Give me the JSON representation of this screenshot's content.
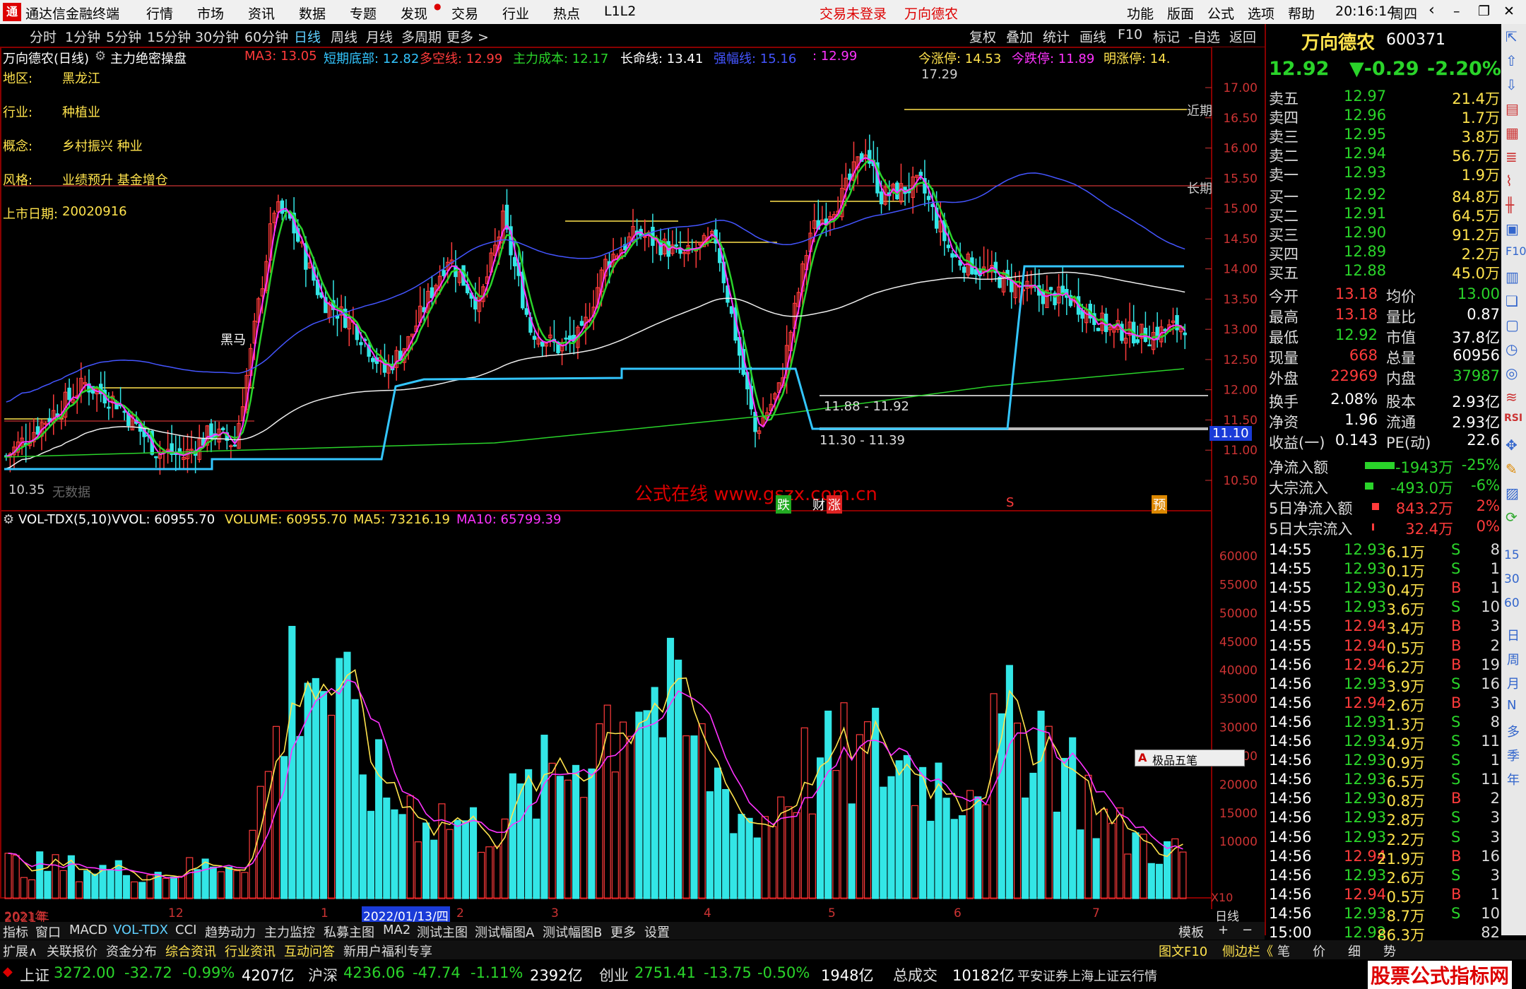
{
  "titlebar": {
    "app_title": "通达信金融终端",
    "menus": [
      "行情",
      "市场",
      "资讯",
      "数据",
      "专题",
      "发现",
      "交易",
      "行业",
      "热点",
      "L1L2"
    ],
    "login_status": "交易未登录",
    "stock_name": "万向德农",
    "right_menus": [
      "功能",
      "版面",
      "公式",
      "选项",
      "帮助"
    ],
    "time": "20:16:14",
    "weekday": "周四"
  },
  "periods": [
    "分时",
    "1分钟",
    "5分钟",
    "15分钟",
    "30分钟",
    "60分钟",
    "日线",
    "周线",
    "月线",
    "多周期",
    "更多 >"
  ],
  "active_period": "日线",
  "chart_tools": [
    "复权",
    "叠加",
    "统计",
    "画线",
    "F10",
    "标记",
    "-自选",
    "返回"
  ],
  "main_chart": {
    "title": "万向德农(日线)",
    "indicator": "主力绝密操盘",
    "ma_labels": [
      {
        "text": "MA3: 13.05",
        "color": "#ff3b3b"
      },
      {
        "text": "短期底部: 12.82",
        "color": "#33c6ff"
      },
      {
        "text": "多空线: 12.99",
        "color": "#ff3b3b"
      },
      {
        "text": "主力成本: 12.17",
        "color": "#2ad42a"
      },
      {
        "text": "长命线: 13.41",
        "color": "#ffffff"
      },
      {
        "text": "强幅线: 15.16",
        "color": "#4455ff"
      },
      {
        "text": ": 12.99",
        "color": "#ff33ff"
      }
    ],
    "limit_labels": [
      {
        "text": "今涨停: 14.53",
        "color": "#ffe34d"
      },
      {
        "text": "今跌停: 11.89",
        "color": "#ff33ff"
      },
      {
        "text": "明涨停: 14.",
        "color": "#ffe34d"
      }
    ],
    "info": [
      {
        "k": "地区:",
        "v": "黑龙江"
      },
      {
        "k": "行业:",
        "v": "种植业"
      },
      {
        "k": "概念:",
        "v": "乡村振兴 种业"
      },
      {
        "k": "风格:",
        "v": "业绩预升 基金增仓"
      },
      {
        "k": "上市日期:",
        "v": "20020916"
      }
    ],
    "y_ticks": [
      "17.00",
      "16.50",
      "16.00",
      "15.50",
      "15.00",
      "14.50",
      "14.00",
      "13.50",
      "13.00",
      "12.50",
      "12.00",
      "11.50",
      "11.00",
      "10.50"
    ],
    "annotations": {
      "high": "17.29",
      "low": "10.35",
      "range1": "11.88 - 11.92",
      "range2": "11.30 - 11.39",
      "near_label": "近期",
      "long_label": "长期",
      "price_tag": "11.10",
      "watermark": "公式在线 www.gszx.com.cn",
      "no_data": "无数据",
      "marks": [
        "跌",
        "财",
        "涨",
        "S",
        "预"
      ],
      "small_mark": "黑马"
    }
  },
  "vol_chart": {
    "title": "VOL-TDX(5,10)",
    "vvol": "VVOL: 60955.70",
    "volume": "VOLUME: 60955.70",
    "ma5": "MA5: 73216.19",
    "ma10": "MA10: 65799.39",
    "y_ticks": [
      "60000",
      "55000",
      "50000",
      "45000",
      "40000",
      "35000",
      "30000",
      "25000",
      "20000",
      "15000",
      "10000"
    ],
    "unit": "X10",
    "ime": "极品五笔"
  },
  "x_labels": [
    "2021年",
    "12",
    "1",
    "2022/01/13/四",
    "2",
    "3",
    "4",
    "5",
    "6",
    "7",
    "日线"
  ],
  "indicator_tabs": [
    "指标",
    "窗口",
    "MACD",
    "VOL-TDX",
    "CCI",
    "趋势动力",
    "主力监控",
    "私募主图",
    "MA2",
    "测试主图",
    "测试幅图A",
    "测试幅图B",
    "更多",
    "设置",
    "模板"
  ],
  "bottom_tabs": [
    "扩展∧",
    "关联报价",
    "资金分布",
    "综合资讯",
    "行业资讯",
    "互动问答",
    "新用户福利专享"
  ],
  "bottom_right": [
    "图文F10",
    "侧边栏《",
    "笔",
    "价",
    "细",
    "势"
  ],
  "quote": {
    "name": "万向德农",
    "code": "600371",
    "price": "12.92",
    "change": "▼-0.29",
    "pct": "-2.20%",
    "asks": [
      {
        "l": "卖五",
        "p": "12.97",
        "v": "21.4万"
      },
      {
        "l": "卖四",
        "p": "12.96",
        "v": "1.7万"
      },
      {
        "l": "卖三",
        "p": "12.95",
        "v": "3.8万"
      },
      {
        "l": "卖二",
        "p": "12.94",
        "v": "56.7万"
      },
      {
        "l": "卖一",
        "p": "12.93",
        "v": "1.9万"
      }
    ],
    "bids": [
      {
        "l": "买一",
        "p": "12.92",
        "v": "84.8万"
      },
      {
        "l": "买二",
        "p": "12.91",
        "v": "64.5万"
      },
      {
        "l": "买三",
        "p": "12.90",
        "v": "91.2万"
      },
      {
        "l": "买四",
        "p": "12.89",
        "v": "2.2万"
      },
      {
        "l": "买五",
        "p": "12.88",
        "v": "45.0万"
      }
    ],
    "stats": [
      {
        "k1": "今开",
        "v1": "13.18",
        "k2": "均价",
        "v2": "13.00"
      },
      {
        "k1": "最高",
        "v1": "13.18",
        "k2": "量比",
        "v2": "0.87"
      },
      {
        "k1": "最低",
        "v1": "12.92",
        "k2": "市值",
        "v2": "37.8亿"
      },
      {
        "k1": "现量",
        "v1": "668",
        "k2": "总量",
        "v2": "60956"
      },
      {
        "k1": "外盘",
        "v1": "22969",
        "k2": "内盘",
        "v2": "37987"
      },
      {
        "k1": "换手",
        "v1": "2.08%",
        "k2": "股本",
        "v2": "2.93亿"
      },
      {
        "k1": "净资",
        "v1": "1.96",
        "k2": "流通",
        "v2": "2.93亿"
      },
      {
        "k1": "收益(一)",
        "v1": "0.143",
        "k2": "PE(动)",
        "v2": "22.6"
      }
    ],
    "flows": [
      {
        "k": "净流入额",
        "v": "-1943万",
        "p": "-25%",
        "bar": 0.42,
        "c": "#2ad42a"
      },
      {
        "k": "大宗流入",
        "v": "-493.0万",
        "p": "-6%",
        "bar": 0.12,
        "c": "#2ad42a"
      },
      {
        "k": "5日净流入额",
        "v": "843.2万",
        "p": "2%",
        "bar": 0.1,
        "c": "#ff3b3b"
      },
      {
        "k": "5日大宗流入",
        "v": "32.4万",
        "p": "0%",
        "bar": 0.02,
        "c": "#ff3b3b"
      }
    ],
    "ticks": [
      {
        "t": "14:55",
        "p": "12.93",
        "v": "6.1万",
        "s": "S",
        "n": "8"
      },
      {
        "t": "14:55",
        "p": "12.93",
        "v": "0.1万",
        "s": "S",
        "n": "1"
      },
      {
        "t": "14:55",
        "p": "12.93",
        "v": "0.4万",
        "s": "B",
        "n": "1"
      },
      {
        "t": "14:55",
        "p": "12.93",
        "v": "3.6万",
        "s": "S",
        "n": "10"
      },
      {
        "t": "14:55",
        "p": "12.94",
        "v": "3.4万",
        "s": "B",
        "n": "3"
      },
      {
        "t": "14:55",
        "p": "12.94",
        "v": "0.5万",
        "s": "B",
        "n": "2"
      },
      {
        "t": "14:56",
        "p": "12.94",
        "v": "6.2万",
        "s": "B",
        "n": "19"
      },
      {
        "t": "14:56",
        "p": "12.93",
        "v": "3.9万",
        "s": "S",
        "n": "16"
      },
      {
        "t": "14:56",
        "p": "12.94",
        "v": "2.6万",
        "s": "B",
        "n": "3"
      },
      {
        "t": "14:56",
        "p": "12.93",
        "v": "1.3万",
        "s": "S",
        "n": "8"
      },
      {
        "t": "14:56",
        "p": "12.93",
        "v": "4.9万",
        "s": "S",
        "n": "11"
      },
      {
        "t": "14:56",
        "p": "12.93",
        "v": "0.9万",
        "s": "S",
        "n": "1"
      },
      {
        "t": "14:56",
        "p": "12.93",
        "v": "6.5万",
        "s": "S",
        "n": "11"
      },
      {
        "t": "14:56",
        "p": "12.93",
        "v": "0.8万",
        "s": "B",
        "n": "2"
      },
      {
        "t": "14:56",
        "p": "12.93",
        "v": "2.8万",
        "s": "S",
        "n": "3"
      },
      {
        "t": "14:56",
        "p": "12.93",
        "v": "2.2万",
        "s": "S",
        "n": "3"
      },
      {
        "t": "14:56",
        "p": "12.94",
        "v": "21.9万",
        "s": "B",
        "n": "16"
      },
      {
        "t": "14:56",
        "p": "12.93",
        "v": "2.6万",
        "s": "S",
        "n": "3"
      },
      {
        "t": "14:56",
        "p": "12.94",
        "v": "0.5万",
        "s": "B",
        "n": "1"
      },
      {
        "t": "14:56",
        "p": "12.93",
        "v": "8.7万",
        "s": "S",
        "n": "10"
      },
      {
        "t": "15:00",
        "p": "12.92",
        "v": "86.3万",
        "s": "",
        "n": "82"
      }
    ]
  },
  "side_tools": [
    "日",
    "周",
    "月",
    "N",
    "多",
    "季",
    "年"
  ],
  "side_numbers": [
    "15",
    "30",
    "60"
  ],
  "status": {
    "items": [
      {
        "name": "上证",
        "val": "3272.00",
        "chg": "-32.72",
        "pct": "-0.99%",
        "amt": "4207亿"
      },
      {
        "name": "沪深",
        "val": "4236.06",
        "chg": "-47.74",
        "pct": "-1.11%",
        "amt": "2392亿"
      },
      {
        "name": "创业",
        "val": "2751.41",
        "chg": "-13.75",
        "pct": "-0.50%",
        "amt": "1948亿"
      }
    ],
    "total_label": "总成交",
    "total": "10182亿",
    "broker": "平安证券上海上证云行情",
    "brand": "股票公式指标网",
    "brand_url": "www.gszx.com.cn"
  },
  "colors": {
    "up": "#ff3b3b",
    "down": "#33e6e6",
    "frame": "#880000"
  }
}
